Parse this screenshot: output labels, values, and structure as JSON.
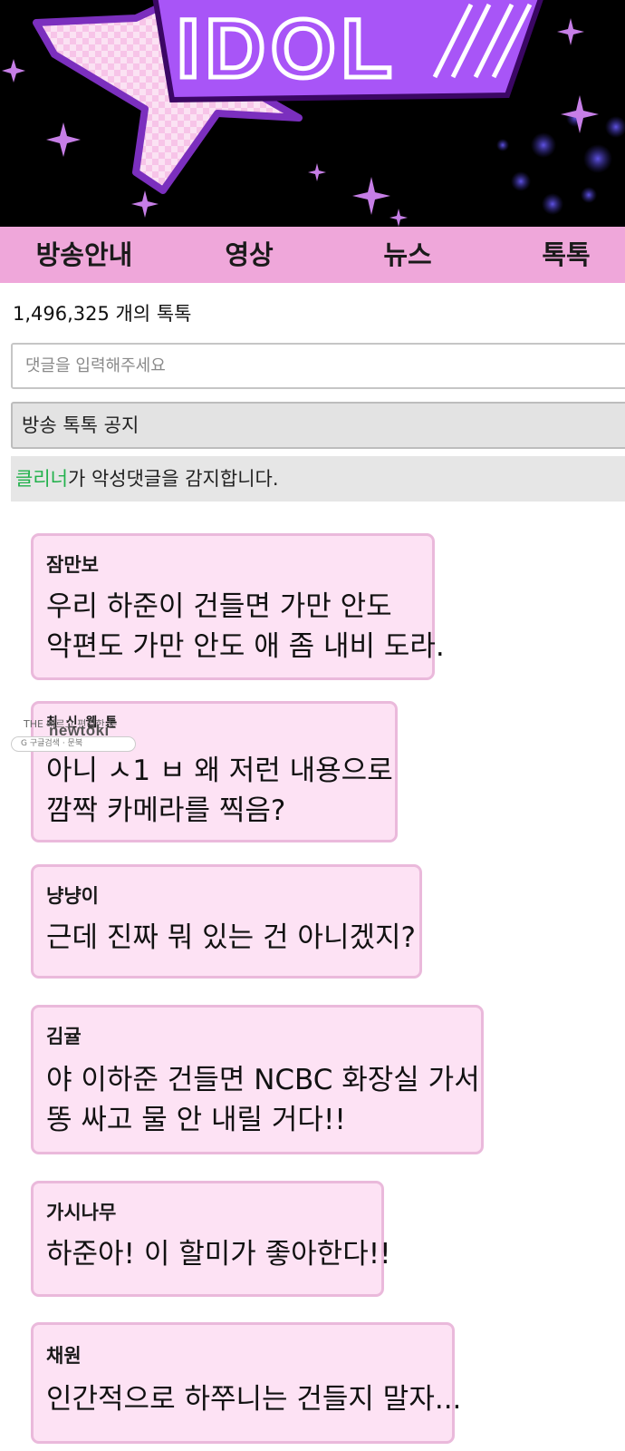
{
  "banner": {
    "logo_text": "IDOL"
  },
  "nav": {
    "items": [
      "방송안내",
      "영상",
      "뉴스",
      "톡톡"
    ]
  },
  "count_text": "1,496,325 개의 톡톡",
  "input": {
    "placeholder": "댓글을 입력해주세요"
  },
  "notice": "방송 톡톡 공지",
  "cleaner": {
    "highlight": "클리너",
    "rest": "가 악성댓글을 감지합니다."
  },
  "watermark": {
    "top": "THE 빠르고 편리한 툰",
    "logo": "newtoki",
    "bar": "G 구글검색 · 문북"
  },
  "comments": [
    {
      "author": "잠만보",
      "lines": [
        "우리 하준이 건들면 가만 안도",
        "악편도 가만 안도 애 좀 내비 도라."
      ]
    },
    {
      "author": "최 신 웹 툰",
      "lines": [
        "아니 ㅅ1 ㅂ 왜 저런 내용으로",
        "깜짝 카메라를 찍음?"
      ]
    },
    {
      "author": "냥냥이",
      "lines": [
        "근데 진짜 뭐 있는 건 아니겠지?"
      ]
    },
    {
      "author": "김귤",
      "lines": [
        "야 이하준 건들면 NCBC 화장실 가서",
        "똥 싸고 물 안 내릴 거다!!"
      ]
    },
    {
      "author": "가시나무",
      "lines": [
        "하준아! 이 할미가 좋아한다!!"
      ]
    },
    {
      "author": "채원",
      "lines": [
        "인간적으로 하쭈니는 건들지 말자..."
      ]
    }
  ],
  "colors": {
    "nav_bg": "#efa7da",
    "bubble_bg": "#fde2f4",
    "bubble_border": "#eab9db",
    "cleaner_green": "#22b14c",
    "logo_purple": "#a855f7"
  }
}
